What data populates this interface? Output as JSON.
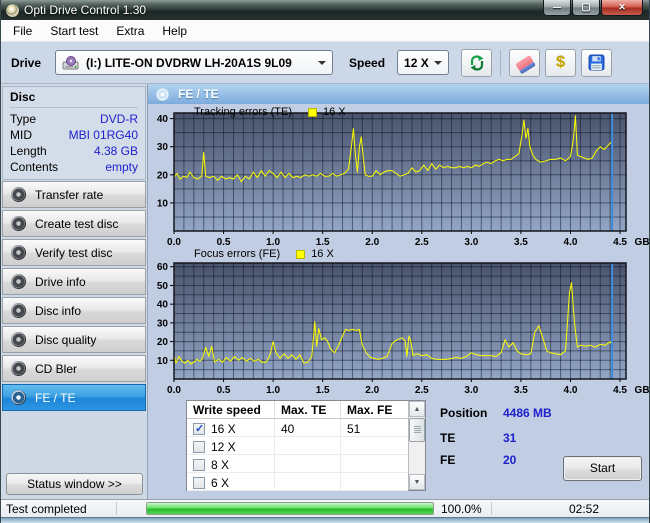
{
  "window": {
    "title": "Opti Drive Control 1.30"
  },
  "menu": {
    "items": [
      "File",
      "Start test",
      "Extra",
      "Help"
    ]
  },
  "toolbar": {
    "drive_label": "Drive",
    "drive_value": "(I:)   LITE-ON DVDRW LH-20A1S 9L09",
    "speed_label": "Speed",
    "speed_value": "12 X"
  },
  "disc_panel": {
    "title": "Disc",
    "rows": [
      {
        "label": "Type",
        "value": "DVD-R"
      },
      {
        "label": "MID",
        "value": "MBI 01RG40"
      },
      {
        "label": "Length",
        "value": "4.38 GB"
      },
      {
        "label": "Contents",
        "value": "empty"
      }
    ]
  },
  "sidebar": {
    "items": [
      {
        "label": "Transfer rate",
        "selected": false
      },
      {
        "label": "Create test disc",
        "selected": false
      },
      {
        "label": "Verify test disc",
        "selected": false
      },
      {
        "label": "Drive info",
        "selected": false
      },
      {
        "label": "Disc info",
        "selected": false
      },
      {
        "label": "Disc quality",
        "selected": false
      },
      {
        "label": "CD Bler",
        "selected": false
      },
      {
        "label": "FE / TE",
        "selected": true
      }
    ],
    "status_window_label": "Status window >>"
  },
  "main_header": "FE / TE",
  "chart_data": [
    {
      "type": "line",
      "title": "Tracking errors (TE)",
      "legend": "16 X",
      "series_color": "#ffff00",
      "ylim": [
        0,
        42
      ],
      "yticks": [
        10,
        20,
        30,
        40
      ],
      "xlim": [
        0,
        4.56
      ],
      "xticks": [
        0,
        0.5,
        1,
        1.5,
        2,
        2.5,
        3,
        3.5,
        4,
        4.5
      ],
      "x_unit": "GB",
      "grid_x_step": 0.1,
      "grid_y_step": 5,
      "cursor_x": 4.42,
      "points": [
        [
          0,
          19
        ],
        [
          0.03,
          20.5
        ],
        [
          0.06,
          18.5
        ],
        [
          0.1,
          19.5
        ],
        [
          0.13,
          19
        ],
        [
          0.16,
          21
        ],
        [
          0.2,
          19
        ],
        [
          0.24,
          18.5
        ],
        [
          0.28,
          19.5
        ],
        [
          0.3,
          28
        ],
        [
          0.32,
          19.5
        ],
        [
          0.36,
          19
        ],
        [
          0.4,
          19.5
        ],
        [
          0.44,
          18
        ],
        [
          0.48,
          19.5
        ],
        [
          0.52,
          18.5
        ],
        [
          0.56,
          19
        ],
        [
          0.6,
          18.5
        ],
        [
          0.64,
          20
        ],
        [
          0.68,
          17.5
        ],
        [
          0.72,
          19.5
        ],
        [
          0.76,
          18.5
        ],
        [
          0.8,
          21
        ],
        [
          0.84,
          19
        ],
        [
          0.88,
          21.5
        ],
        [
          0.92,
          19.5
        ],
        [
          0.96,
          21.5
        ],
        [
          1,
          20.5
        ],
        [
          1.04,
          19
        ],
        [
          1.08,
          21
        ],
        [
          1.12,
          19
        ],
        [
          1.16,
          20.5
        ],
        [
          1.2,
          19
        ],
        [
          1.24,
          19.5
        ],
        [
          1.28,
          19
        ],
        [
          1.32,
          20
        ],
        [
          1.36,
          19.5
        ],
        [
          1.4,
          20
        ],
        [
          1.44,
          19.5
        ],
        [
          1.48,
          20.5
        ],
        [
          1.52,
          19.5
        ],
        [
          1.56,
          19.5
        ],
        [
          1.6,
          20.5
        ],
        [
          1.64,
          19.5
        ],
        [
          1.68,
          20
        ],
        [
          1.72,
          20.5
        ],
        [
          1.76,
          22
        ],
        [
          1.79,
          30
        ],
        [
          1.81,
          36.5
        ],
        [
          1.83,
          27
        ],
        [
          1.85,
          21
        ],
        [
          1.87,
          30
        ],
        [
          1.89,
          33.5
        ],
        [
          1.91,
          26
        ],
        [
          1.93,
          20
        ],
        [
          1.96,
          19.5
        ],
        [
          2,
          19.5
        ],
        [
          2.04,
          21.5
        ],
        [
          2.08,
          20
        ],
        [
          2.12,
          21
        ],
        [
          2.16,
          21.5
        ],
        [
          2.2,
          21.5
        ],
        [
          2.24,
          20.5
        ],
        [
          2.28,
          19.5
        ],
        [
          2.32,
          20
        ],
        [
          2.36,
          20.5
        ],
        [
          2.4,
          22.5
        ],
        [
          2.44,
          21
        ],
        [
          2.48,
          21.5
        ],
        [
          2.52,
          23.5
        ],
        [
          2.56,
          21.5
        ],
        [
          2.6,
          24
        ],
        [
          2.64,
          22
        ],
        [
          2.68,
          23.5
        ],
        [
          2.72,
          22.5
        ],
        [
          2.76,
          23
        ],
        [
          2.8,
          22.5
        ],
        [
          2.84,
          22.5
        ],
        [
          2.88,
          23
        ],
        [
          2.92,
          22.5
        ],
        [
          2.96,
          23
        ],
        [
          3,
          22.5
        ],
        [
          3.04,
          23.5
        ],
        [
          3.08,
          23
        ],
        [
          3.12,
          24
        ],
        [
          3.16,
          24.5
        ],
        [
          3.2,
          24
        ],
        [
          3.24,
          25
        ],
        [
          3.28,
          25.5
        ],
        [
          3.32,
          25
        ],
        [
          3.36,
          25.5
        ],
        [
          3.4,
          25.5
        ],
        [
          3.44,
          26.5
        ],
        [
          3.48,
          27.5
        ],
        [
          3.51,
          34
        ],
        [
          3.53,
          39.5
        ],
        [
          3.55,
          33
        ],
        [
          3.57,
          36.5
        ],
        [
          3.59,
          30
        ],
        [
          3.62,
          27
        ],
        [
          3.65,
          25.5
        ],
        [
          3.7,
          24.5
        ],
        [
          3.75,
          25
        ],
        [
          3.8,
          25.5
        ],
        [
          3.85,
          25.5
        ],
        [
          3.9,
          26
        ],
        [
          3.95,
          25
        ],
        [
          4,
          26.5
        ],
        [
          4.03,
          33
        ],
        [
          4.05,
          41
        ],
        [
          4.07,
          27
        ],
        [
          4.1,
          26.5
        ],
        [
          4.14,
          26
        ],
        [
          4.18,
          25.5
        ],
        [
          4.22,
          26
        ],
        [
          4.26,
          28.5
        ],
        [
          4.3,
          30
        ],
        [
          4.34,
          29
        ],
        [
          4.38,
          30.5
        ],
        [
          4.42,
          32
        ]
      ]
    },
    {
      "type": "line",
      "title": "Focus errors (FE)",
      "legend": "16 X",
      "series_color": "#ffff00",
      "ylim": [
        0,
        62
      ],
      "yticks": [
        10,
        20,
        30,
        40,
        50,
        60
      ],
      "xlim": [
        0,
        4.56
      ],
      "xticks": [
        0,
        0.5,
        1,
        1.5,
        2,
        2.5,
        3,
        3.5,
        4,
        4.5
      ],
      "x_unit": "GB",
      "grid_x_step": 0.1,
      "grid_y_step": 5,
      "cursor_x": 4.42,
      "points": [
        [
          0,
          13
        ],
        [
          0.02,
          8.5
        ],
        [
          0.05,
          12
        ],
        [
          0.08,
          9.5
        ],
        [
          0.11,
          8.5
        ],
        [
          0.14,
          10
        ],
        [
          0.17,
          8
        ],
        [
          0.2,
          9
        ],
        [
          0.23,
          10.5
        ],
        [
          0.26,
          9.5
        ],
        [
          0.29,
          11
        ],
        [
          0.32,
          17
        ],
        [
          0.35,
          12
        ],
        [
          0.38,
          17.5
        ],
        [
          0.41,
          9
        ],
        [
          0.45,
          10.5
        ],
        [
          0.49,
          9
        ],
        [
          0.53,
          11.5
        ],
        [
          0.57,
          9.5
        ],
        [
          0.61,
          12
        ],
        [
          0.65,
          10
        ],
        [
          0.69,
          11.5
        ],
        [
          0.73,
          9.5
        ],
        [
          0.77,
          11
        ],
        [
          0.81,
          9.5
        ],
        [
          0.85,
          10.5
        ],
        [
          0.89,
          9
        ],
        [
          0.93,
          9
        ],
        [
          0.97,
          13
        ],
        [
          1,
          20
        ],
        [
          1.03,
          14
        ],
        [
          1.07,
          11
        ],
        [
          1.11,
          13.5
        ],
        [
          1.15,
          11
        ],
        [
          1.19,
          13
        ],
        [
          1.23,
          10.5
        ],
        [
          1.27,
          13
        ],
        [
          1.31,
          8.5
        ],
        [
          1.35,
          9
        ],
        [
          1.39,
          12
        ],
        [
          1.42,
          30.5
        ],
        [
          1.44,
          17.5
        ],
        [
          1.46,
          27
        ],
        [
          1.49,
          21
        ],
        [
          1.52,
          22
        ],
        [
          1.55,
          20
        ],
        [
          1.58,
          16
        ],
        [
          1.62,
          14
        ],
        [
          1.66,
          18
        ],
        [
          1.7,
          23
        ],
        [
          1.73,
          26.5
        ],
        [
          1.76,
          26
        ],
        [
          1.8,
          26.5
        ],
        [
          1.84,
          26
        ],
        [
          1.87,
          26.5
        ],
        [
          1.9,
          18
        ],
        [
          1.94,
          14
        ],
        [
          1.98,
          11.5
        ],
        [
          2.02,
          11
        ],
        [
          2.06,
          10.5
        ],
        [
          2.1,
          11
        ],
        [
          2.15,
          12
        ],
        [
          2.2,
          19
        ],
        [
          2.25,
          21
        ],
        [
          2.3,
          22
        ],
        [
          2.33,
          20.5
        ],
        [
          2.35,
          12
        ],
        [
          2.37,
          23
        ],
        [
          2.39,
          20
        ],
        [
          2.41,
          12.5
        ],
        [
          2.45,
          13.5
        ],
        [
          2.5,
          12.5
        ],
        [
          2.55,
          13
        ],
        [
          2.6,
          11
        ],
        [
          2.65,
          10.5
        ],
        [
          2.7,
          10.5
        ],
        [
          2.75,
          10.5
        ],
        [
          2.8,
          11
        ],
        [
          2.85,
          11.5
        ],
        [
          2.9,
          11
        ],
        [
          2.95,
          12
        ],
        [
          3,
          14
        ],
        [
          3.05,
          13
        ],
        [
          3.1,
          12.5
        ],
        [
          3.15,
          12.5
        ],
        [
          3.2,
          12.5
        ],
        [
          3.25,
          12
        ],
        [
          3.3,
          14
        ],
        [
          3.34,
          21
        ],
        [
          3.38,
          17
        ],
        [
          3.42,
          19.5
        ],
        [
          3.46,
          15
        ],
        [
          3.5,
          13.5
        ],
        [
          3.55,
          13
        ],
        [
          3.6,
          13.5
        ],
        [
          3.64,
          25
        ],
        [
          3.68,
          28.5
        ],
        [
          3.72,
          22
        ],
        [
          3.76,
          15
        ],
        [
          3.8,
          14
        ],
        [
          3.85,
          13.5
        ],
        [
          3.9,
          13
        ],
        [
          3.95,
          15
        ],
        [
          3.99,
          46
        ],
        [
          4.01,
          51.5
        ],
        [
          4.04,
          30
        ],
        [
          4.07,
          17
        ],
        [
          4.1,
          18
        ],
        [
          4.15,
          17.5
        ],
        [
          4.2,
          18
        ],
        [
          4.25,
          17
        ],
        [
          4.3,
          18.5
        ],
        [
          4.35,
          18
        ],
        [
          4.4,
          20
        ],
        [
          4.42,
          18
        ]
      ]
    }
  ],
  "table": {
    "headers": [
      "Write speed",
      "Max. TE",
      "Max. FE"
    ],
    "rows": [
      {
        "checked": true,
        "speed": "16 X",
        "max_te": "40",
        "max_fe": "51"
      },
      {
        "checked": false,
        "speed": "12 X",
        "max_te": "",
        "max_fe": ""
      },
      {
        "checked": false,
        "speed": "8 X",
        "max_te": "",
        "max_fe": ""
      },
      {
        "checked": false,
        "speed": "6 X",
        "max_te": "",
        "max_fe": ""
      }
    ]
  },
  "info": {
    "position_label": "Position",
    "position_value": "4486 MB",
    "te_label": "TE",
    "te_value": "31",
    "fe_label": "FE",
    "fe_value": "20",
    "start_label": "Start"
  },
  "statusbar": {
    "status": "Test completed",
    "progress_percent": "100.0%",
    "progress_value": 100,
    "time": "02:52"
  },
  "colors": {
    "accent_selected": "#2e97e5",
    "value_text": "#2020cd",
    "chart_line": "#ffff00",
    "chart_cursor": "#3e8ddd",
    "chart_bg_top": "#49536c",
    "chart_bg_bottom": "#93a6c6",
    "progress_green": "#3ecc3e"
  }
}
